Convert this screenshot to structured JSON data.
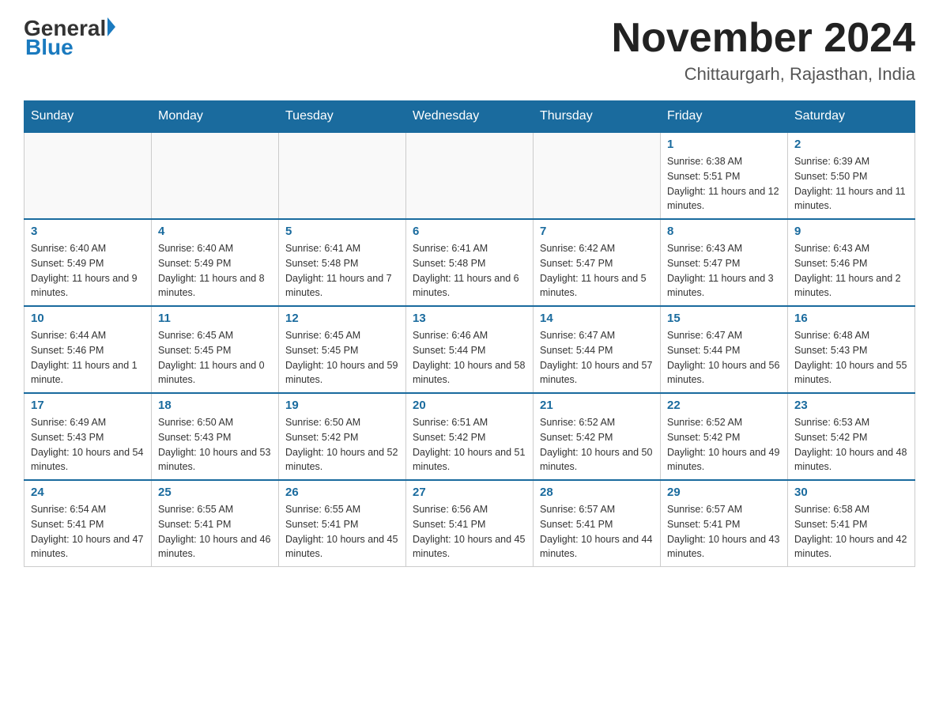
{
  "header": {
    "logo_general": "General",
    "logo_blue": "Blue",
    "month_title": "November 2024",
    "location": "Chittaurgarh, Rajasthan, India"
  },
  "days_of_week": [
    "Sunday",
    "Monday",
    "Tuesday",
    "Wednesday",
    "Thursday",
    "Friday",
    "Saturday"
  ],
  "weeks": [
    [
      {
        "day": "",
        "info": ""
      },
      {
        "day": "",
        "info": ""
      },
      {
        "day": "",
        "info": ""
      },
      {
        "day": "",
        "info": ""
      },
      {
        "day": "",
        "info": ""
      },
      {
        "day": "1",
        "info": "Sunrise: 6:38 AM\nSunset: 5:51 PM\nDaylight: 11 hours and 12 minutes."
      },
      {
        "day": "2",
        "info": "Sunrise: 6:39 AM\nSunset: 5:50 PM\nDaylight: 11 hours and 11 minutes."
      }
    ],
    [
      {
        "day": "3",
        "info": "Sunrise: 6:40 AM\nSunset: 5:49 PM\nDaylight: 11 hours and 9 minutes."
      },
      {
        "day": "4",
        "info": "Sunrise: 6:40 AM\nSunset: 5:49 PM\nDaylight: 11 hours and 8 minutes."
      },
      {
        "day": "5",
        "info": "Sunrise: 6:41 AM\nSunset: 5:48 PM\nDaylight: 11 hours and 7 minutes."
      },
      {
        "day": "6",
        "info": "Sunrise: 6:41 AM\nSunset: 5:48 PM\nDaylight: 11 hours and 6 minutes."
      },
      {
        "day": "7",
        "info": "Sunrise: 6:42 AM\nSunset: 5:47 PM\nDaylight: 11 hours and 5 minutes."
      },
      {
        "day": "8",
        "info": "Sunrise: 6:43 AM\nSunset: 5:47 PM\nDaylight: 11 hours and 3 minutes."
      },
      {
        "day": "9",
        "info": "Sunrise: 6:43 AM\nSunset: 5:46 PM\nDaylight: 11 hours and 2 minutes."
      }
    ],
    [
      {
        "day": "10",
        "info": "Sunrise: 6:44 AM\nSunset: 5:46 PM\nDaylight: 11 hours and 1 minute."
      },
      {
        "day": "11",
        "info": "Sunrise: 6:45 AM\nSunset: 5:45 PM\nDaylight: 11 hours and 0 minutes."
      },
      {
        "day": "12",
        "info": "Sunrise: 6:45 AM\nSunset: 5:45 PM\nDaylight: 10 hours and 59 minutes."
      },
      {
        "day": "13",
        "info": "Sunrise: 6:46 AM\nSunset: 5:44 PM\nDaylight: 10 hours and 58 minutes."
      },
      {
        "day": "14",
        "info": "Sunrise: 6:47 AM\nSunset: 5:44 PM\nDaylight: 10 hours and 57 minutes."
      },
      {
        "day": "15",
        "info": "Sunrise: 6:47 AM\nSunset: 5:44 PM\nDaylight: 10 hours and 56 minutes."
      },
      {
        "day": "16",
        "info": "Sunrise: 6:48 AM\nSunset: 5:43 PM\nDaylight: 10 hours and 55 minutes."
      }
    ],
    [
      {
        "day": "17",
        "info": "Sunrise: 6:49 AM\nSunset: 5:43 PM\nDaylight: 10 hours and 54 minutes."
      },
      {
        "day": "18",
        "info": "Sunrise: 6:50 AM\nSunset: 5:43 PM\nDaylight: 10 hours and 53 minutes."
      },
      {
        "day": "19",
        "info": "Sunrise: 6:50 AM\nSunset: 5:42 PM\nDaylight: 10 hours and 52 minutes."
      },
      {
        "day": "20",
        "info": "Sunrise: 6:51 AM\nSunset: 5:42 PM\nDaylight: 10 hours and 51 minutes."
      },
      {
        "day": "21",
        "info": "Sunrise: 6:52 AM\nSunset: 5:42 PM\nDaylight: 10 hours and 50 minutes."
      },
      {
        "day": "22",
        "info": "Sunrise: 6:52 AM\nSunset: 5:42 PM\nDaylight: 10 hours and 49 minutes."
      },
      {
        "day": "23",
        "info": "Sunrise: 6:53 AM\nSunset: 5:42 PM\nDaylight: 10 hours and 48 minutes."
      }
    ],
    [
      {
        "day": "24",
        "info": "Sunrise: 6:54 AM\nSunset: 5:41 PM\nDaylight: 10 hours and 47 minutes."
      },
      {
        "day": "25",
        "info": "Sunrise: 6:55 AM\nSunset: 5:41 PM\nDaylight: 10 hours and 46 minutes."
      },
      {
        "day": "26",
        "info": "Sunrise: 6:55 AM\nSunset: 5:41 PM\nDaylight: 10 hours and 45 minutes."
      },
      {
        "day": "27",
        "info": "Sunrise: 6:56 AM\nSunset: 5:41 PM\nDaylight: 10 hours and 45 minutes."
      },
      {
        "day": "28",
        "info": "Sunrise: 6:57 AM\nSunset: 5:41 PM\nDaylight: 10 hours and 44 minutes."
      },
      {
        "day": "29",
        "info": "Sunrise: 6:57 AM\nSunset: 5:41 PM\nDaylight: 10 hours and 43 minutes."
      },
      {
        "day": "30",
        "info": "Sunrise: 6:58 AM\nSunset: 5:41 PM\nDaylight: 10 hours and 42 minutes."
      }
    ]
  ]
}
